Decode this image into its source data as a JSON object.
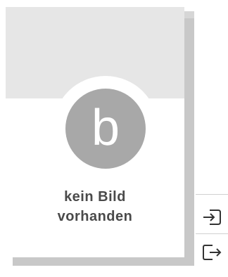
{
  "cover": {
    "placeholder_line1": "kein Bild",
    "placeholder_line2": "vorhanden",
    "logo_letter": "b",
    "logo_icon": "b-logo-icon"
  },
  "actions": [
    {
      "icon": "sign-in-icon"
    },
    {
      "icon": "sign-out-icon"
    }
  ],
  "colors": {
    "band": "#e6e6e6",
    "logo": "#a8a8a8",
    "text": "#4a4a4a",
    "shadow": "#c8c8c8"
  }
}
